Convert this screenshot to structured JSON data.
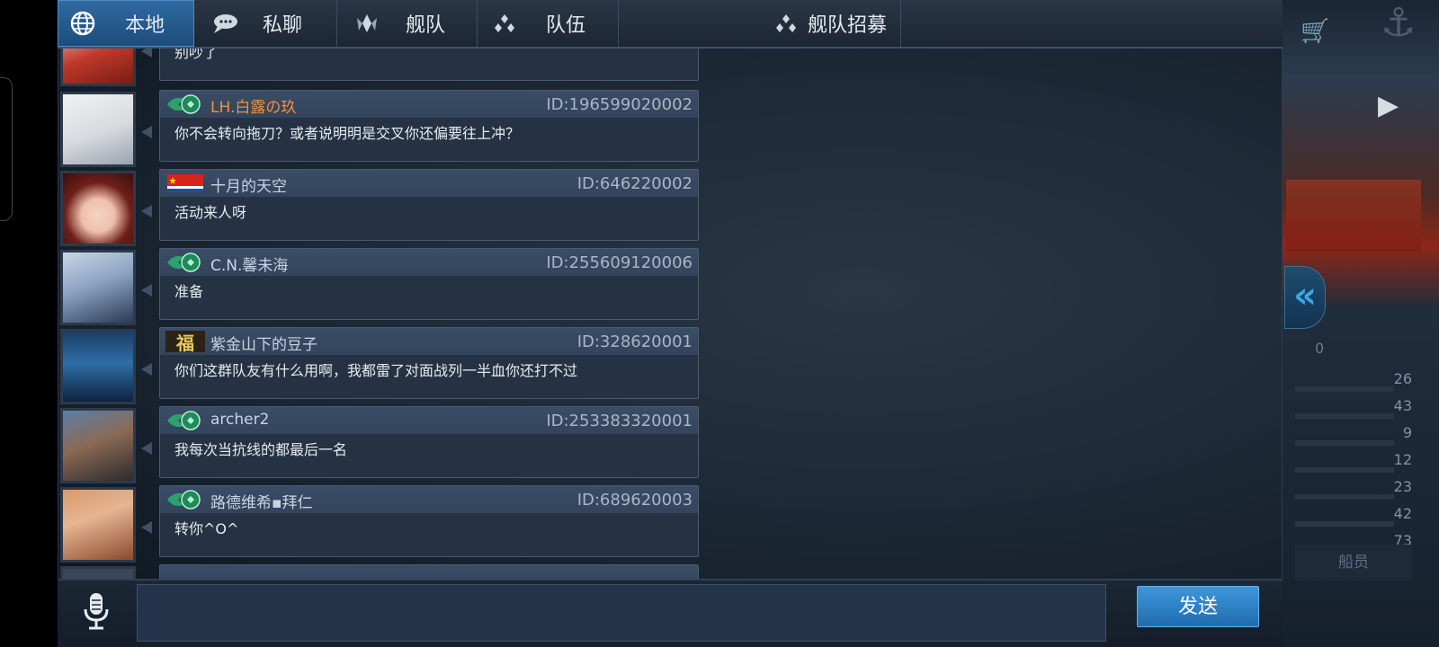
{
  "tabs": [
    {
      "label": "本地",
      "icon": "globe-icon",
      "active": true
    },
    {
      "label": "私聊",
      "icon": "speech-bubble-icon",
      "active": false
    },
    {
      "label": "舰队",
      "icon": "fleet-emblem-icon",
      "active": false
    },
    {
      "label": "队伍",
      "icon": "team-dots-icon",
      "active": false
    },
    {
      "label": "舰队招募",
      "icon": "team-dots-icon",
      "active": false
    }
  ],
  "messages": [
    {
      "name": "",
      "id": "",
      "text": "别吵了",
      "badge": "none"
    },
    {
      "name": "LH.白露の玖",
      "id": "ID:196599020002",
      "text": "你不会转向拖刀？或者说明明是交叉你还偏要往上冲？",
      "badge": "green-wing",
      "name_color": "orange"
    },
    {
      "name": "十月的天空",
      "id": "ID:646220002",
      "text": "活动来人呀",
      "badge": "navy-flag"
    },
    {
      "name": "C.N.馨未海",
      "id": "ID:255609120006",
      "text": "准备",
      "badge": "green-wing"
    },
    {
      "name": "紫金山下的豆子",
      "id": "ID:328620001",
      "text": "你们这群队友有什么用啊，我都雷了对面战列一半血你还打不过",
      "badge": "fu-character",
      "badge_text": "福"
    },
    {
      "name": "archer2",
      "id": "ID:253383320001",
      "text": "我每次当抗线的都最后一名",
      "badge": "green-wing"
    },
    {
      "name": "路德维希▪拜仁",
      "id": "ID:689620003",
      "text": "转你^O^",
      "badge": "green-wing"
    }
  ],
  "input": {
    "placeholder": ""
  },
  "send_label": "发送",
  "right_panel": {
    "zero": "0",
    "stats": [
      "26",
      "43",
      "9",
      "12",
      "23",
      "42",
      "73"
    ],
    "crew_label": "船员"
  },
  "colors": {
    "accent": "#2f6aa1",
    "send": "#2a86cc",
    "orange_name": "#f0913a"
  }
}
